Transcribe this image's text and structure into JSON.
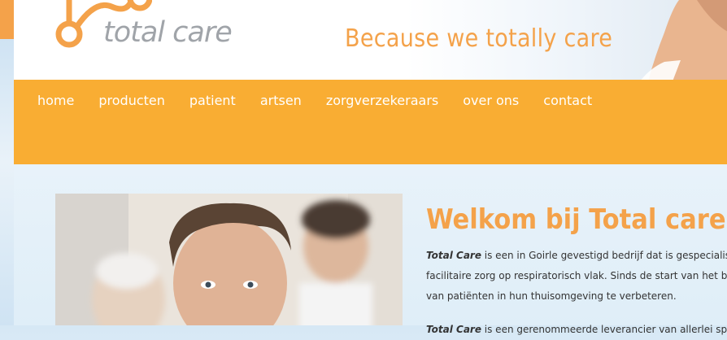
{
  "header": {
    "logo_text": "total care",
    "tagline": "Because we totally care"
  },
  "nav": {
    "items": [
      {
        "label": "home"
      },
      {
        "label": "producten"
      },
      {
        "label": "patient"
      },
      {
        "label": "artsen"
      },
      {
        "label": "zorgverzekeraars"
      },
      {
        "label": "over ons"
      },
      {
        "label": "contact"
      }
    ]
  },
  "main": {
    "title": "Welkom bij Total care",
    "paragraph1": {
      "brand": "Total Care",
      "line1": " is een in Goirle gevestigd bedrijf dat is gespecialiseer",
      "line2": "facilitaire zorg op respiratorisch vlak. Sinds de start van het bedr",
      "line3": "van patiënten in hun thuisomgeving te verbeteren."
    },
    "paragraph2": {
      "brand": "Total Care",
      "line1": " is een gerenommeerde leverancier van allerlei special"
    }
  },
  "colors": {
    "accent": "#f4a24a",
    "nav_bg": "#f9ad33",
    "logo_gray": "#a0a4a9"
  }
}
